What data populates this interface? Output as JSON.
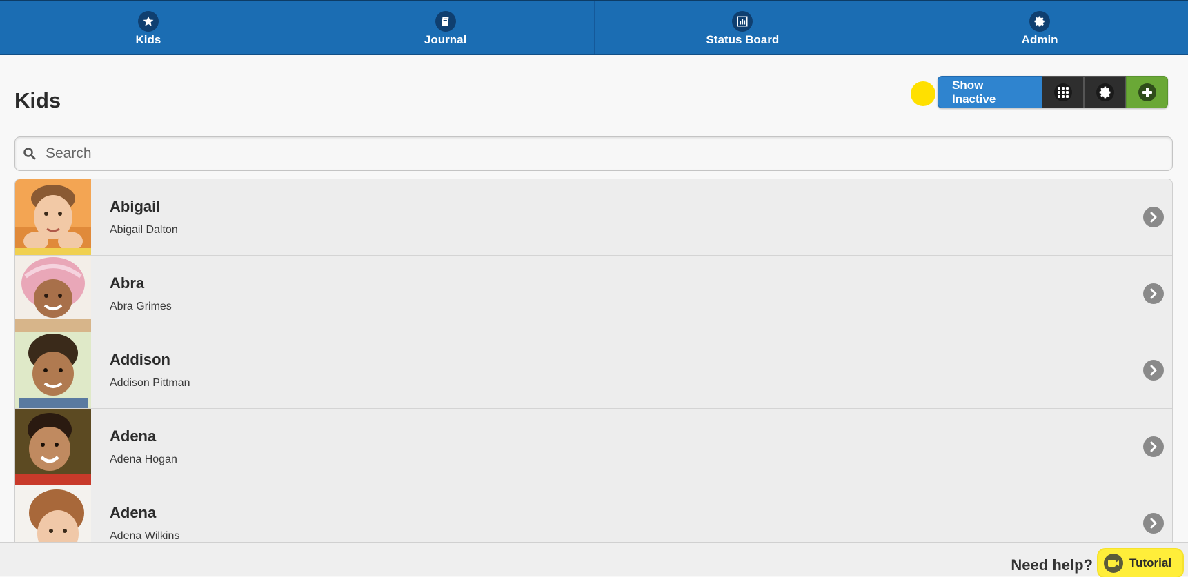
{
  "nav": {
    "items": [
      {
        "label": "Kids",
        "icon": "star-icon"
      },
      {
        "label": "Journal",
        "icon": "book-icon"
      },
      {
        "label": "Status Board",
        "icon": "bar-chart-icon"
      },
      {
        "label": "Admin",
        "icon": "gear-icon"
      }
    ]
  },
  "header": {
    "title": "Kids",
    "show_inactive_label": "Show Inactive",
    "grid_icon": "grid-icon",
    "settings_icon": "gear-icon",
    "add_icon": "plus-icon"
  },
  "search": {
    "placeholder": "Search",
    "value": ""
  },
  "kids": [
    {
      "first_name": "Abigail",
      "full_name": "Abigail Dalton",
      "photo_bg": "#f3a553"
    },
    {
      "first_name": "Abra",
      "full_name": "Abra Grimes",
      "photo_bg": "#e9c7cf"
    },
    {
      "first_name": "Addison",
      "full_name": "Addison Pittman",
      "photo_bg": "#dfe9c8"
    },
    {
      "first_name": "Adena",
      "full_name": "Adena Hogan",
      "photo_bg": "#5c4a22"
    },
    {
      "first_name": "Adena",
      "full_name": "Adena Wilkins",
      "photo_bg": "#f4f2ee"
    }
  ],
  "footer": {
    "need_help": "Need help?",
    "tutorial_label": "Tutorial"
  },
  "colors": {
    "nav_bg": "#1b6db3",
    "show_inactive_bg": "#2f84cf",
    "add_bg": "#6aa836",
    "tutorial_bg": "#ffee3a",
    "indicator": "#ffe000"
  }
}
